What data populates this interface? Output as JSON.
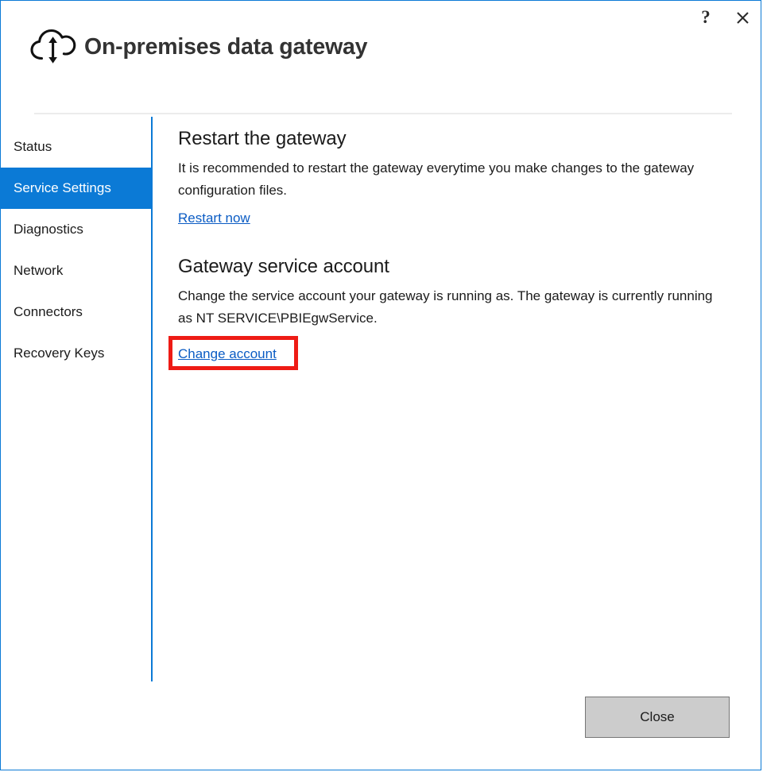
{
  "window": {
    "border_color": "#0b7ad6",
    "accent_color": "#0b7ad6",
    "link_color": "#0b5cc4",
    "highlight_color": "#ee1b15"
  },
  "titlebar": {
    "app_title": "On-premises data gateway",
    "icon": "cloud-sync-icon",
    "help_label": "?",
    "close_label": "✕"
  },
  "sidebar": {
    "items": [
      {
        "label": "Status",
        "selected": false
      },
      {
        "label": "Service Settings",
        "selected": true
      },
      {
        "label": "Diagnostics",
        "selected": false
      },
      {
        "label": "Network",
        "selected": false
      },
      {
        "label": "Connectors",
        "selected": false
      },
      {
        "label": "Recovery Keys",
        "selected": false
      }
    ]
  },
  "content": {
    "restart_section": {
      "heading": "Restart the gateway",
      "body": "It is recommended to restart the gateway everytime you make changes to the gateway configuration files.",
      "link": "Restart now"
    },
    "account_section": {
      "heading": "Gateway service account",
      "body": "Change the service account your gateway is running as. The gateway is currently running as NT SERVICE\\PBIEgwService.",
      "link": "Change account"
    }
  },
  "footer": {
    "close_label": "Close"
  }
}
